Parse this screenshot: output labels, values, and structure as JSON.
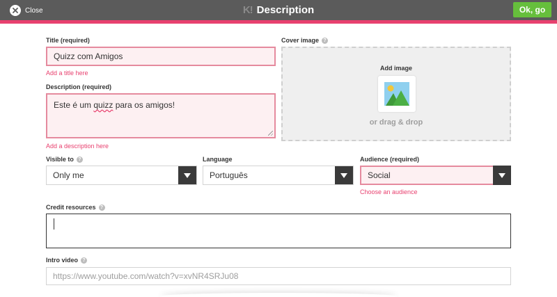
{
  "header": {
    "close_label": "Close",
    "logo": "K!",
    "title": "Description",
    "ok_label": "Ok, go",
    "colors": {
      "bar": "#5b5b5b",
      "accent": "#e8416f",
      "ok": "#66bf3c"
    }
  },
  "form": {
    "title": {
      "label": "Title (required)",
      "value": "Quizz com Amigos",
      "error": "Add a title here"
    },
    "description": {
      "label": "Description (required)",
      "value_before": "Este é um ",
      "value_misspelled": "quizz",
      "value_after": " para os amigos!",
      "error": "Add a description here"
    },
    "cover": {
      "label": "Cover image",
      "add_image": "Add image",
      "drag_drop": "or drag & drop",
      "icon": "image-placeholder-icon"
    },
    "visible_to": {
      "label": "Visible to",
      "selected": "Only me"
    },
    "language": {
      "label": "Language",
      "selected": "Português"
    },
    "audience": {
      "label": "Audience (required)",
      "selected": "Social",
      "error": "Choose an audience"
    },
    "credit_resources": {
      "label": "Credit resources",
      "value": ""
    },
    "intro_video": {
      "label": "Intro video",
      "placeholder": "https://www.youtube.com/watch?v=xvNR4SRJu08"
    }
  }
}
